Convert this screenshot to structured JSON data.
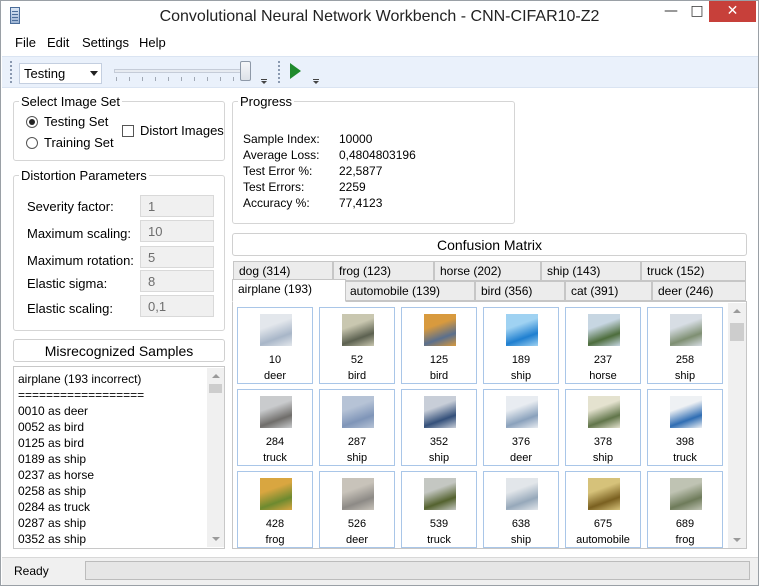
{
  "window": {
    "title": "Convolutional Neural Network Workbench - CNN-CIFAR10-Z2",
    "minimize_glyph": "—",
    "maximize_glyph": "□",
    "close_glyph": "✕"
  },
  "menu": [
    "File",
    "Edit",
    "Settings",
    "Help"
  ],
  "toolbar": {
    "mode_value": "Testing",
    "slider_level": 1.0
  },
  "image_set": {
    "legend": "Select Image Set",
    "testing_label": "Testing Set",
    "training_label": "Training Set",
    "selected": "Testing Set",
    "distort_label": "Distort Images",
    "distort_checked": false
  },
  "distortion": {
    "legend": "Distortion Parameters",
    "params": [
      {
        "label": "Severity factor:",
        "value": "1"
      },
      {
        "label": "Maximum scaling:",
        "value": "10"
      },
      {
        "label": "Maximum rotation:",
        "value": "5"
      },
      {
        "label": "Elastic sigma:",
        "value": "8"
      },
      {
        "label": "Elastic scaling:",
        "value": "0,1"
      }
    ]
  },
  "progress": {
    "legend": "Progress",
    "rows": [
      {
        "label": "Sample Index:",
        "value": "10000"
      },
      {
        "label": "Average Loss:",
        "value": "0,4804803196"
      },
      {
        "label": "Test Error %:",
        "value": "22,5877"
      },
      {
        "label": "Test Errors:",
        "value": "2259"
      },
      {
        "label": "Accuracy %:",
        "value": "77,4123"
      }
    ]
  },
  "misrecognized": {
    "title": "Misrecognized Samples",
    "lines": [
      "airplane (193 incorrect)",
      "==================",
      "0010 as deer",
      "0052 as bird",
      "0125 as bird",
      "0189 as ship",
      "0237 as horse",
      "0258 as ship",
      "0284 as truck",
      "0287 as ship",
      "0352 as ship"
    ]
  },
  "confusion": {
    "title": "Confusion Matrix",
    "tabs_back": [
      "dog (314)",
      "frog (123)",
      "horse (202)",
      "ship (143)",
      "truck (152)"
    ],
    "tabs_front": [
      "airplane (193)",
      "automobile (139)",
      "bird (356)",
      "cat (391)",
      "deer (246)"
    ],
    "active_tab": "airplane (193)",
    "samples": [
      {
        "index": "10",
        "label": "deer",
        "colors": [
          "#a8b6c8",
          "#e3e7ec"
        ]
      },
      {
        "index": "52",
        "label": "bird",
        "colors": [
          "#5c6150",
          "#c9c7b0"
        ]
      },
      {
        "index": "125",
        "label": "bird",
        "colors": [
          "#5a6f8d",
          "#d89a3e"
        ]
      },
      {
        "index": "189",
        "label": "ship",
        "colors": [
          "#1f7fd0",
          "#9fd2f2"
        ]
      },
      {
        "index": "237",
        "label": "horse",
        "colors": [
          "#4d6d3c",
          "#c7d6e2"
        ]
      },
      {
        "index": "258",
        "label": "ship",
        "colors": [
          "#7e8f72",
          "#d7dde4"
        ]
      },
      {
        "index": "284",
        "label": "truck",
        "colors": [
          "#6f6d6a",
          "#c9cbcd"
        ]
      },
      {
        "index": "287",
        "label": "ship",
        "colors": [
          "#7f95b8",
          "#b6c3d6"
        ]
      },
      {
        "index": "352",
        "label": "ship",
        "colors": [
          "#34507a",
          "#c8ced8"
        ]
      },
      {
        "index": "376",
        "label": "deer",
        "colors": [
          "#8aa1bc",
          "#e8ecf1"
        ]
      },
      {
        "index": "378",
        "label": "ship",
        "colors": [
          "#61754a",
          "#e4e2cf"
        ]
      },
      {
        "index": "398",
        "label": "truck",
        "colors": [
          "#2f6db3",
          "#eef1f4"
        ]
      },
      {
        "index": "428",
        "label": "frog",
        "colors": [
          "#6d8a2f",
          "#d9a640"
        ]
      },
      {
        "index": "526",
        "label": "deer",
        "colors": [
          "#8d8a86",
          "#c8c3ba"
        ]
      },
      {
        "index": "539",
        "label": "truck",
        "colors": [
          "#54622f",
          "#c4c7c2"
        ]
      },
      {
        "index": "638",
        "label": "ship",
        "colors": [
          "#96a8ba",
          "#e2e6ea"
        ]
      },
      {
        "index": "675",
        "label": "automobile",
        "colors": [
          "#7a6020",
          "#d6c27a"
        ]
      },
      {
        "index": "689",
        "label": "frog",
        "colors": [
          "#6e7b5a",
          "#bfc3b3"
        ]
      }
    ]
  },
  "status": {
    "text": "Ready",
    "progress": 0.0
  },
  "colors": {
    "toolbar_bg": "#eaf1fb",
    "close_button": "#c7403a",
    "cell_border": "#a9c6e8",
    "play_green": "#1f8a2d"
  }
}
